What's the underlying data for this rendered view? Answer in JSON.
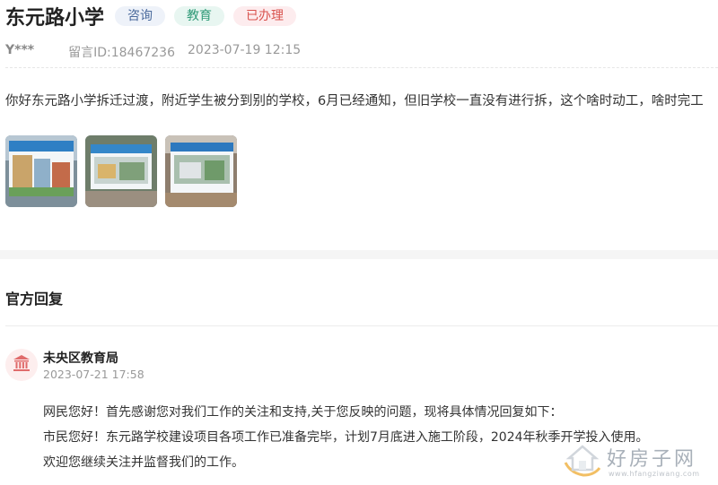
{
  "header": {
    "title": "东元路小学",
    "tags": [
      {
        "label": "咨询",
        "color": "#4a6a9c"
      },
      {
        "label": "教育",
        "color": "#2f9a77"
      },
      {
        "label": "已办理",
        "color": "#d9534f"
      }
    ]
  },
  "meta": {
    "user": "Y***",
    "message_id": "留言ID:18467236",
    "datetime": "2023-07-19 12:15"
  },
  "message": {
    "content": "你好东元路小学拆迁过渡，附近学生被分到别的学校，6月已经通知，但旧学校一直没有进行拆，这个啥时动工，啥时完工",
    "images": [
      "photo-1",
      "photo-2",
      "photo-3"
    ]
  },
  "official_reply": {
    "section_title": "官方回复",
    "org_name": "未央区教育局",
    "avatar_icon": "government-building-icon",
    "datetime": "2023-07-21 17:58",
    "paragraphs": [
      "网民您好！首先感谢您对我们工作的关注和支持,关于您反映的问题，现将具体情况回复如下：",
      "市民您好！东元路学校建设项目各项工作已准备完毕，计划7月底进入施工阶段，2024年秋季开学投入使用。",
      "欢迎您继续关注并监督我们的工作。"
    ]
  },
  "watermark": {
    "text": "好房子网",
    "url": "www.hfangziwang.com"
  }
}
